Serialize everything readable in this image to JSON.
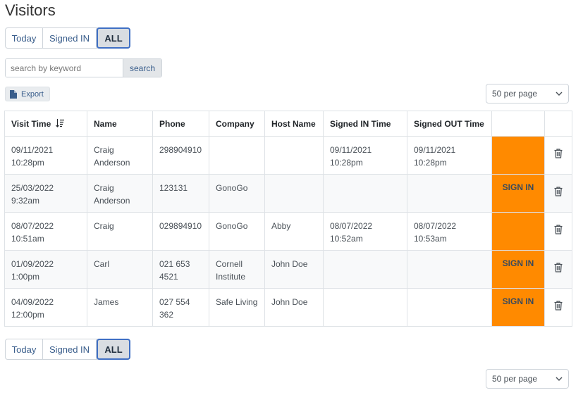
{
  "page": {
    "title": "Visitors"
  },
  "filters": {
    "today": "Today",
    "signed_in": "Signed IN",
    "all": "ALL"
  },
  "search": {
    "placeholder": "search by keyword",
    "button": "search"
  },
  "export_label": "Export",
  "per_page": {
    "selected": "50 per page"
  },
  "table": {
    "headers": [
      "Visit Time",
      "Name",
      "Phone",
      "Company",
      "Host Name",
      "Signed IN Time",
      "Signed OUT Time",
      "",
      ""
    ],
    "rows": [
      {
        "visit_date": "09/11/2021",
        "visit_time": "10:28pm",
        "name1": "Craig",
        "name2": "Anderson",
        "phone1": "298904910",
        "phone2": "",
        "company1": "",
        "company2": "",
        "host": "",
        "in_date": "09/11/2021",
        "in_time": "10:28pm",
        "out_date": "09/11/2021",
        "out_time": "10:28pm",
        "action": ""
      },
      {
        "visit_date": "25/03/2022",
        "visit_time": "9:32am",
        "name1": "Craig",
        "name2": "Anderson",
        "phone1": "123131",
        "phone2": "",
        "company1": "GonoGo",
        "company2": "",
        "host": "",
        "in_date": "",
        "in_time": "",
        "out_date": "",
        "out_time": "",
        "action": "SIGN IN"
      },
      {
        "visit_date": "08/07/2022",
        "visit_time": "10:51am",
        "name1": "Craig",
        "name2": "",
        "phone1": "029894910",
        "phone2": "",
        "company1": "GonoGo",
        "company2": "",
        "host": "Abby",
        "in_date": "08/07/2022",
        "in_time": "10:52am",
        "out_date": "08/07/2022",
        "out_time": "10:53am",
        "action": ""
      },
      {
        "visit_date": "01/09/2022",
        "visit_time": "1:00pm",
        "name1": "Carl",
        "name2": "",
        "phone1": "021 653",
        "phone2": "4521",
        "company1": "Cornell",
        "company2": "Institute",
        "host": "John Doe",
        "in_date": "",
        "in_time": "",
        "out_date": "",
        "out_time": "",
        "action": "SIGN IN"
      },
      {
        "visit_date": "04/09/2022",
        "visit_time": "12:00pm",
        "name1": "James",
        "name2": "",
        "phone1": "027 554",
        "phone2": "362",
        "company1": "Safe Living",
        "company2": "",
        "host": "John Doe",
        "in_date": "",
        "in_time": "",
        "out_date": "",
        "out_time": "",
        "action": "SIGN IN"
      }
    ]
  },
  "colors": {
    "accent": "#ff8a00",
    "active_border": "#3f6fc4",
    "link": "#3a5e8c"
  },
  "icons": {
    "sort": "sort-descending-icon",
    "delete": "trash-icon",
    "export": "file-icon",
    "dropdown": "chevron-down-icon"
  }
}
